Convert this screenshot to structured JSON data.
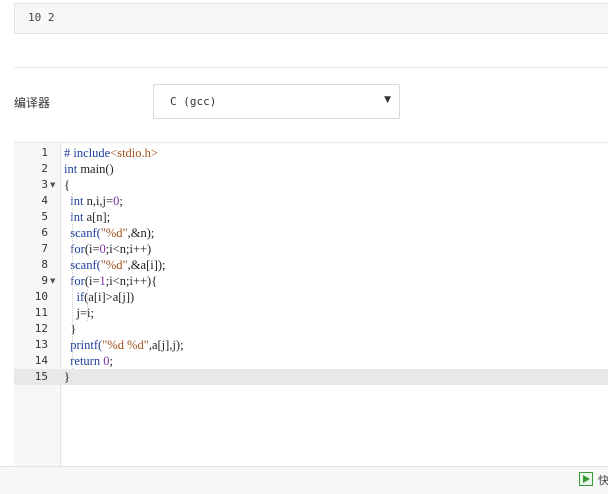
{
  "input": {
    "value": "10 2"
  },
  "compiler": {
    "label": "编译器",
    "value": "C (gcc)"
  },
  "editor": {
    "lines": [
      {
        "num": "1",
        "fold": false,
        "tokens": [
          {
            "t": "# include",
            "c": "k"
          },
          {
            "t": "<stdio.h>",
            "c": "p"
          }
        ]
      },
      {
        "num": "2",
        "fold": false,
        "tokens": [
          {
            "t": "int",
            "c": "k"
          },
          {
            "t": " main()",
            "c": ""
          }
        ]
      },
      {
        "num": "3",
        "fold": true,
        "tokens": [
          {
            "t": "{",
            "c": ""
          }
        ]
      },
      {
        "num": "4",
        "fold": false,
        "tokens": [
          {
            "t": "  ",
            "c": ""
          },
          {
            "t": "int",
            "c": "k"
          },
          {
            "t": " n,i,j=",
            "c": ""
          },
          {
            "t": "0",
            "c": "n"
          },
          {
            "t": ";",
            "c": ""
          }
        ]
      },
      {
        "num": "5",
        "fold": false,
        "tokens": [
          {
            "t": "  ",
            "c": ""
          },
          {
            "t": "int",
            "c": "k"
          },
          {
            "t": " a[n];",
            "c": ""
          }
        ]
      },
      {
        "num": "6",
        "fold": false,
        "tokens": [
          {
            "t": "  ",
            "c": ""
          },
          {
            "t": "scanf(",
            "c": "k"
          },
          {
            "t": "\"%d\"",
            "c": "s"
          },
          {
            "t": ",&n);",
            "c": ""
          }
        ]
      },
      {
        "num": "7",
        "fold": false,
        "tokens": [
          {
            "t": "  ",
            "c": ""
          },
          {
            "t": "for",
            "c": "k"
          },
          {
            "t": "(i=",
            "c": ""
          },
          {
            "t": "0",
            "c": "n"
          },
          {
            "t": ";i<n;i++)",
            "c": ""
          }
        ]
      },
      {
        "num": "8",
        "fold": false,
        "tokens": [
          {
            "t": "  ",
            "c": ""
          },
          {
            "t": "scanf(",
            "c": "k"
          },
          {
            "t": "\"%d\"",
            "c": "s"
          },
          {
            "t": ",&a[i]);",
            "c": ""
          }
        ]
      },
      {
        "num": "9",
        "fold": true,
        "tokens": [
          {
            "t": "  ",
            "c": ""
          },
          {
            "t": "for",
            "c": "k"
          },
          {
            "t": "(i=",
            "c": ""
          },
          {
            "t": "1",
            "c": "n"
          },
          {
            "t": ";i<n;i++){",
            "c": ""
          }
        ]
      },
      {
        "num": "10",
        "fold": false,
        "tokens": [
          {
            "t": "    ",
            "c": ""
          },
          {
            "t": "if",
            "c": "k"
          },
          {
            "t": "(a[i]>a[j])",
            "c": ""
          }
        ]
      },
      {
        "num": "11",
        "fold": false,
        "tokens": [
          {
            "t": "    j=i;",
            "c": ""
          }
        ]
      },
      {
        "num": "12",
        "fold": false,
        "tokens": [
          {
            "t": "  }",
            "c": ""
          }
        ]
      },
      {
        "num": "13",
        "fold": false,
        "tokens": [
          {
            "t": "  ",
            "c": ""
          },
          {
            "t": "printf(",
            "c": "k"
          },
          {
            "t": "\"%d %d\"",
            "c": "s"
          },
          {
            "t": ",a[j],j);",
            "c": ""
          }
        ]
      },
      {
        "num": "14",
        "fold": false,
        "tokens": [
          {
            "t": "  ",
            "c": ""
          },
          {
            "t": "return",
            "c": "k"
          },
          {
            "t": " ",
            "c": ""
          },
          {
            "t": "0",
            "c": "n"
          },
          {
            "t": ";",
            "c": ""
          }
        ]
      },
      {
        "num": "15",
        "fold": false,
        "active": true,
        "tokens": [
          {
            "t": "}",
            "c": ""
          }
        ]
      }
    ]
  },
  "footer": {
    "run_icon": "play-icon",
    "run_label": "快"
  }
}
